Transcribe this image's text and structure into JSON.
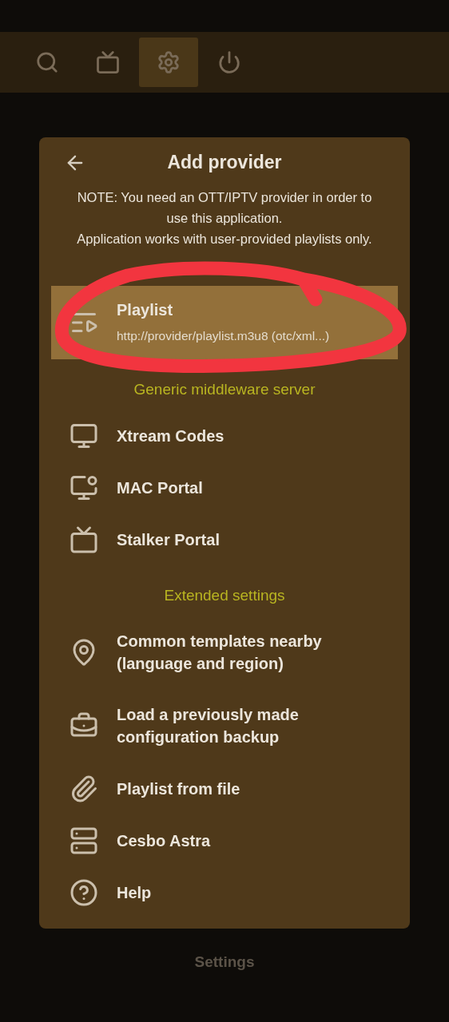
{
  "top_bar": {
    "tabs": [
      {
        "selected": false
      },
      {
        "selected": false
      },
      {
        "selected": true
      },
      {
        "selected": false
      }
    ]
  },
  "dialog": {
    "title": "Add provider",
    "note": [
      "NOTE: You need an OTT/IPTV provider in order to use this application.",
      "Application works with user-provided playlists only."
    ],
    "rows": [
      {
        "kind": "item",
        "label": "Playlist",
        "subtitle": "http://provider/playlist.m3u8 (otc/xml...)",
        "selected": true
      },
      {
        "kind": "heading",
        "label": "Generic middleware server"
      },
      {
        "kind": "item",
        "label": "Xtream Codes",
        "selected": false
      },
      {
        "kind": "item",
        "label": "MAC Portal",
        "selected": false
      },
      {
        "kind": "item",
        "label": "Stalker Portal",
        "selected": false
      },
      {
        "kind": "heading",
        "label": "Extended settings"
      },
      {
        "kind": "item",
        "label": "Common templates nearby (language and region)",
        "selected": false
      },
      {
        "kind": "item",
        "label": "Load a previously made configuration backup",
        "selected": false
      },
      {
        "kind": "item",
        "label": "Playlist from file",
        "selected": false
      },
      {
        "kind": "item",
        "label": "Cesbo Astra",
        "selected": false
      },
      {
        "kind": "item",
        "label": "Help",
        "selected": false
      }
    ]
  },
  "bottom_label": "Settings"
}
